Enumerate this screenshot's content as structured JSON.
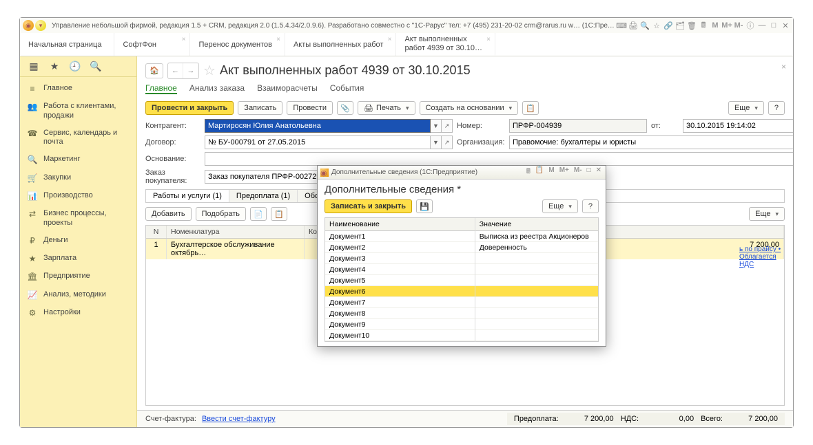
{
  "titlebar": {
    "text": "Управление небольшой фирмой, редакция 1.5 + CRM, редакция 2.0 (1.5.4.34/2.0.9.6). Разработано совместно с \"1С-Рарус\" тел: +7 (495) 231-20-02 crm@rarus.ru w…  (1С:Предприятие)",
    "m1": "M",
    "m2": "M+",
    "m3": "M-"
  },
  "tabs": [
    {
      "label": "Начальная страница",
      "closable": false
    },
    {
      "label": "СофтФон",
      "closable": true
    },
    {
      "label": "Перенос документов",
      "closable": true
    },
    {
      "label": "Акты выполненных работ",
      "closable": true
    },
    {
      "label": "Акт выполненных",
      "label2": "работ 4939 от 30.10…",
      "active": true,
      "closable": true
    }
  ],
  "sidebar": {
    "items": [
      {
        "icon": "≡",
        "label": "Главное"
      },
      {
        "icon": "👥",
        "label": "Работа с клиентами, продажи"
      },
      {
        "icon": "☎",
        "label": "Сервис, календарь и почта"
      },
      {
        "icon": "🔍",
        "label": "Маркетинг"
      },
      {
        "icon": "🛒",
        "label": "Закупки"
      },
      {
        "icon": "📊",
        "label": "Производство"
      },
      {
        "icon": "⇄",
        "label": "Бизнес процессы, проекты"
      },
      {
        "icon": "₽",
        "label": "Деньги"
      },
      {
        "icon": "★",
        "label": "Зарплата"
      },
      {
        "icon": "🏛",
        "label": "Предприятие"
      },
      {
        "icon": "📈",
        "label": "Анализ, методики"
      },
      {
        "icon": "⚙",
        "label": "Настройки"
      }
    ]
  },
  "doc": {
    "title": "Акт выполненных работ 4939 от 30.10.2015",
    "sectionTabs": [
      "Главное",
      "Анализ заказа",
      "Взаиморасчеты",
      "События"
    ],
    "toolbar": {
      "postClose": "Провести и закрыть",
      "save": "Записать",
      "post": "Провести",
      "print": "Печать",
      "createBasedOn": "Создать на основании",
      "more": "Еще",
      "help": "?"
    },
    "fields": {
      "contragentLabel": "Контрагент:",
      "contragentValue": "Мартиросян Юлия Анатольевна",
      "numberLabel": "Номер:",
      "numberValue": "ПРФР-004939",
      "otLabel": "от:",
      "dateValue": "30.10.2015 19:14:02",
      "contractLabel": "Договор:",
      "contractValue": "№ БУ-000791 от 27.05.2015",
      "orgLabel": "Организация:",
      "orgValue": "Правомочие: бухгалтеры и юристы",
      "basisLabel": "Основание:",
      "basisValue": "",
      "orderLabel": "Заказ покупателя:",
      "orderValue": "Заказ покупателя ПРФР-002729 от 2"
    },
    "linkSnippet": "ь по прайсу • Облагается НДС",
    "innerTabs": [
      "Работы и услуги (1)",
      "Предоплата (1)",
      "Обсуждения"
    ],
    "gridTools": {
      "add": "Добавить",
      "pick": "Подобрать"
    },
    "gridHead": {
      "n": "N",
      "nomen": "Номенклатура",
      "kol": "Коли"
    },
    "gridRow": {
      "n": "1",
      "nomen": "Бухгалтерское обслуживание октябрь…",
      "sum": "7 200,00"
    },
    "footer": {
      "sfLabel": "Счет-фактура:",
      "sfLink": "Ввести счет-фактуру",
      "prepayLabel": "Предоплата:",
      "prepayValue": "7 200,00",
      "ndsLabel": "НДС:",
      "ndsValue": "0,00",
      "totalLabel": "Всего:",
      "totalValue": "7 200,00"
    }
  },
  "modal": {
    "winTitle": "Дополнительные сведения  (1С:Предприятие)",
    "title": "Дополнительные сведения *",
    "saveClose": "Записать и закрыть",
    "more": "Еще",
    "help": "?",
    "head": {
      "name": "Наименование",
      "value": "Значение"
    },
    "rows": [
      {
        "name": "Документ1",
        "value": "Выписка из реестра Акционеров"
      },
      {
        "name": "Документ2",
        "value": "Доверенность"
      },
      {
        "name": "Документ3",
        "value": ""
      },
      {
        "name": "Документ4",
        "value": ""
      },
      {
        "name": "Документ5",
        "value": ""
      },
      {
        "name": "Документ6",
        "value": "",
        "hl": true
      },
      {
        "name": "Документ7",
        "value": ""
      },
      {
        "name": "Документ8",
        "value": ""
      },
      {
        "name": "Документ9",
        "value": ""
      },
      {
        "name": "Документ10",
        "value": ""
      }
    ],
    "m1": "M",
    "m2": "M+",
    "m3": "M-"
  }
}
